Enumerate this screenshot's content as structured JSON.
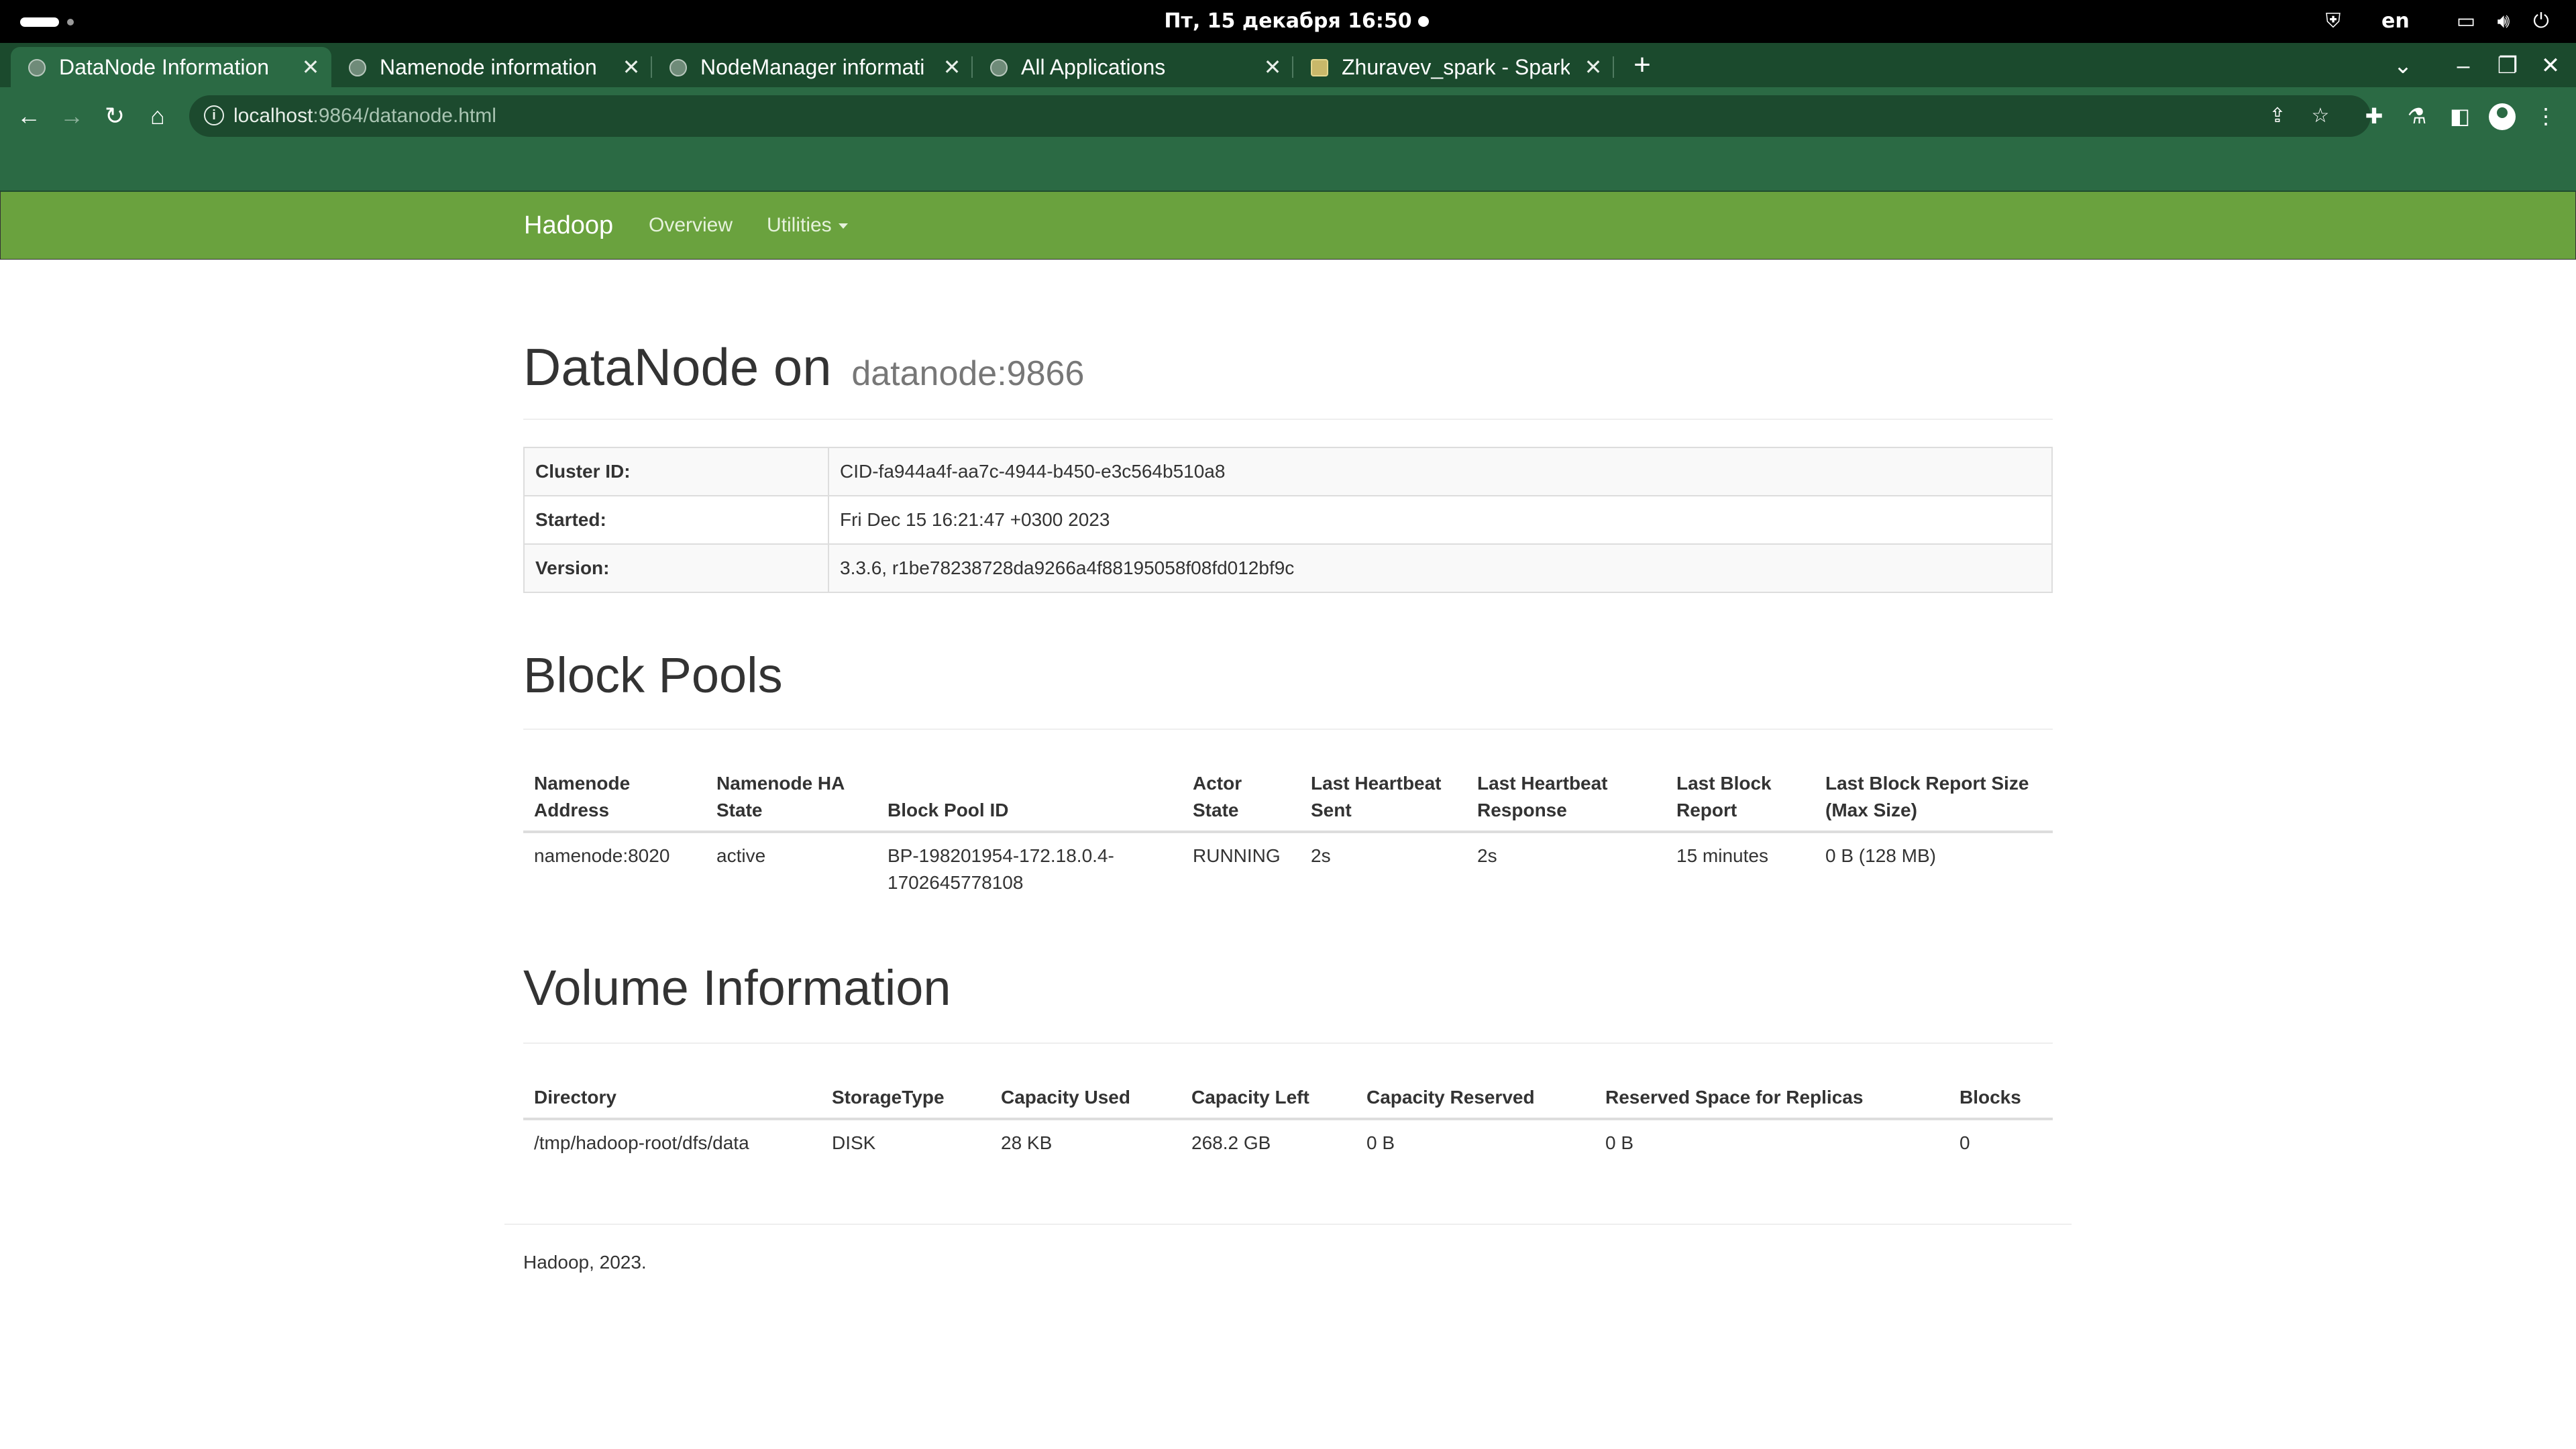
{
  "system": {
    "clock": "Пт, 15 декабря  16:50",
    "language": "en"
  },
  "browser": {
    "tabs": [
      {
        "label": "DataNode Information",
        "active": true
      },
      {
        "label": "Namenode information",
        "active": false
      },
      {
        "label": "NodeManager informati",
        "active": false
      },
      {
        "label": "All Applications",
        "active": false
      },
      {
        "label": "Zhuravev_spark - Spark J",
        "active": false
      }
    ],
    "url_host": "localhost",
    "url_path": ":9864/datanode.html"
  },
  "navbar": {
    "brand": "Hadoop",
    "overview": "Overview",
    "utilities": "Utilities"
  },
  "page": {
    "title": "DataNode on",
    "subtitle": "datanode:9866"
  },
  "info_table": [
    {
      "key": "Cluster ID:",
      "value": "CID-fa944a4f-aa7c-4944-b450-e3c564b510a8"
    },
    {
      "key": "Started:",
      "value": "Fri Dec 15 16:21:47 +0300 2023"
    },
    {
      "key": "Version:",
      "value": "3.3.6, r1be78238728da9266a4f88195058f08fd012bf9c"
    }
  ],
  "block_pools": {
    "heading": "Block Pools",
    "columns": [
      "Namenode Address",
      "Namenode HA State",
      "Block Pool ID",
      "Actor State",
      "Last Heartbeat Sent",
      "Last Heartbeat Response",
      "Last Block Report",
      "Last Block Report Size (Max Size)"
    ],
    "rows": [
      [
        "namenode:8020",
        "active",
        "BP-198201954-172.18.0.4-1702645778108",
        "RUNNING",
        "2s",
        "2s",
        "15 minutes",
        "0 B (128 MB)"
      ]
    ]
  },
  "volumes": {
    "heading": "Volume Information",
    "columns": [
      "Directory",
      "StorageType",
      "Capacity Used",
      "Capacity Left",
      "Capacity Reserved",
      "Reserved Space for Replicas",
      "Blocks"
    ],
    "rows": [
      [
        "/tmp/hadoop-root/dfs/data",
        "DISK",
        "28 KB",
        "268.2 GB",
        "0 B",
        "0 B",
        "0"
      ]
    ]
  },
  "footer": "Hadoop, 2023.",
  "colors": {
    "navbar_green": "#6aa23e",
    "browser_frame": "#2b6a44"
  }
}
